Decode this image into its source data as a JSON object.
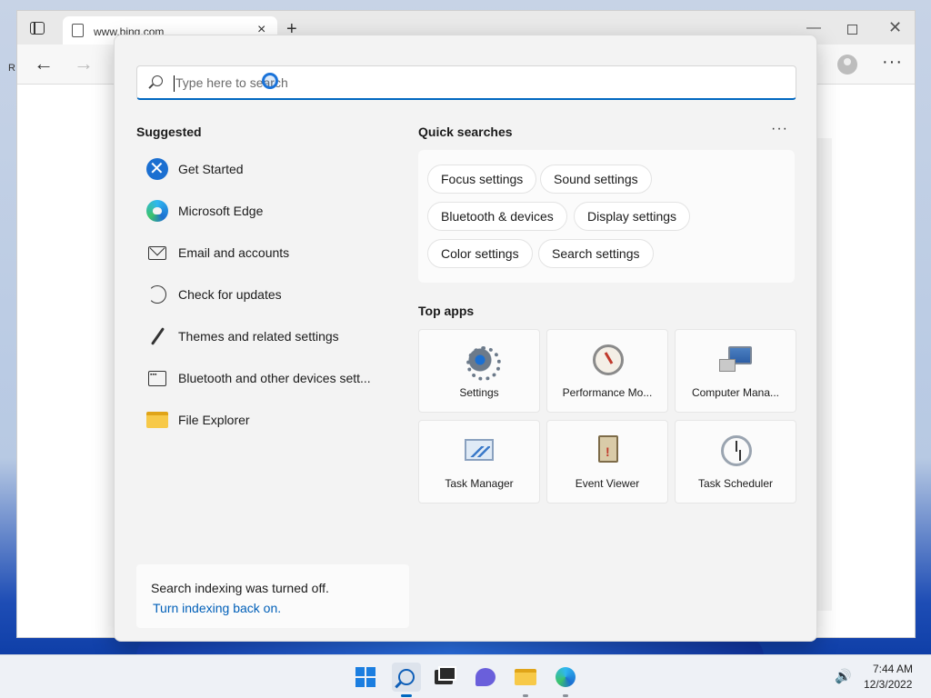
{
  "browser": {
    "tab_title": "www.bing.com",
    "tab_close": "×",
    "new_tab": "+",
    "minimize": "—",
    "close": "✕",
    "back": "←",
    "forward": "→",
    "more": "···",
    "partial_letter": "R"
  },
  "search": {
    "placeholder": "Type here to search",
    "value": ""
  },
  "suggested": {
    "title": "Suggested",
    "items": [
      {
        "label": "Get Started",
        "icon": "get-started-icon"
      },
      {
        "label": "Microsoft Edge",
        "icon": "edge-icon"
      },
      {
        "label": "Email and accounts",
        "icon": "mail-icon"
      },
      {
        "label": "Check for updates",
        "icon": "refresh-icon"
      },
      {
        "label": "Themes and related settings",
        "icon": "brush-icon"
      },
      {
        "label": "Bluetooth and other devices sett...",
        "icon": "devices-icon"
      },
      {
        "label": "File Explorer",
        "icon": "folder-icon"
      }
    ]
  },
  "quick_searches": {
    "title": "Quick searches",
    "more": "···",
    "chips": [
      "Focus settings",
      "Sound settings",
      "Bluetooth & devices",
      "Display settings",
      "Color settings",
      "Search settings"
    ]
  },
  "top_apps": {
    "title": "Top apps",
    "apps": [
      {
        "label": "Settings",
        "icon": "settings-gear-icon"
      },
      {
        "label": "Performance Mo...",
        "icon": "performance-monitor-icon"
      },
      {
        "label": "Computer Mana...",
        "icon": "computer-management-icon"
      },
      {
        "label": "Task Manager",
        "icon": "task-manager-icon"
      },
      {
        "label": "Event Viewer",
        "icon": "event-viewer-icon"
      },
      {
        "label": "Task Scheduler",
        "icon": "task-scheduler-icon"
      }
    ]
  },
  "notice": {
    "text": "Search indexing was turned off.",
    "link": "Turn indexing back on."
  },
  "taskbar": {
    "volume": "🔊",
    "time": "7:44 AM",
    "date": "12/3/2022"
  },
  "colors": {
    "accent": "#0067c0",
    "link": "#005fb8"
  }
}
